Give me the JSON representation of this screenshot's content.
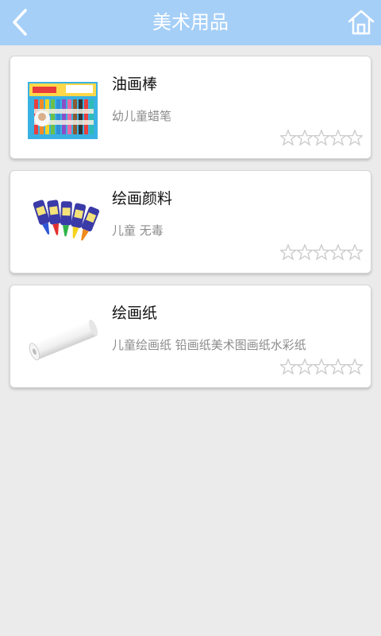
{
  "header": {
    "title": "美术用品",
    "back_icon": "chevron-left-icon",
    "home_icon": "home-icon"
  },
  "products": [
    {
      "name": "油画棒",
      "desc": "幼儿童蜡笔",
      "rating": 0,
      "max_rating": 5,
      "image": "crayon-box"
    },
    {
      "name": "绘画颜料",
      "desc": "儿童 无毒",
      "rating": 0,
      "max_rating": 5,
      "image": "paint-bottles"
    },
    {
      "name": "绘画纸",
      "desc": "儿童绘画纸 铅画纸美术图画纸水彩纸",
      "rating": 0,
      "max_rating": 5,
      "image": "paper-roll"
    }
  ],
  "colors": {
    "header_bg": "#a5cff7",
    "header_text": "#ffffff",
    "page_bg": "#ebebeb",
    "card_bg": "#ffffff",
    "desc_text": "#8c8c8c",
    "star_outline": "#cccccc"
  }
}
